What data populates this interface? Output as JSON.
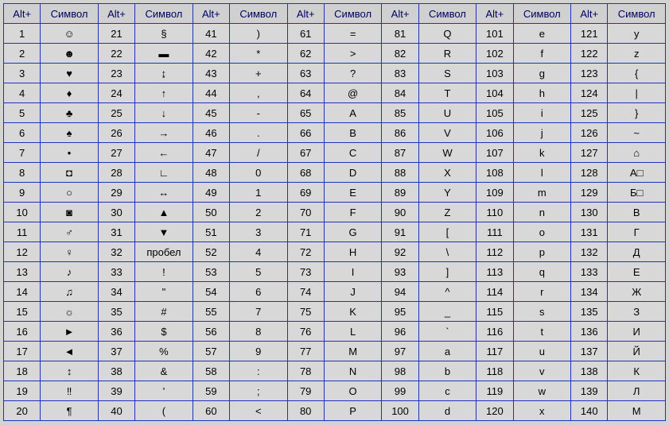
{
  "headers": {
    "alt": "Alt+",
    "symbol": "Символ"
  },
  "columns": [
    [
      {
        "alt": "1",
        "sym": "☺"
      },
      {
        "alt": "2",
        "sym": "☻"
      },
      {
        "alt": "3",
        "sym": "♥"
      },
      {
        "alt": "4",
        "sym": "♦"
      },
      {
        "alt": "5",
        "sym": "♣"
      },
      {
        "alt": "6",
        "sym": "♠"
      },
      {
        "alt": "7",
        "sym": "•"
      },
      {
        "alt": "8",
        "sym": "◘"
      },
      {
        "alt": "9",
        "sym": "○"
      },
      {
        "alt": "10",
        "sym": "◙"
      },
      {
        "alt": "11",
        "sym": "♂"
      },
      {
        "alt": "12",
        "sym": "♀"
      },
      {
        "alt": "13",
        "sym": "♪"
      },
      {
        "alt": "14",
        "sym": "♫"
      },
      {
        "alt": "15",
        "sym": "☼"
      },
      {
        "alt": "16",
        "sym": "►"
      },
      {
        "alt": "17",
        "sym": "◄"
      },
      {
        "alt": "18",
        "sym": "↕"
      },
      {
        "alt": "19",
        "sym": "‼"
      },
      {
        "alt": "20",
        "sym": "¶"
      }
    ],
    [
      {
        "alt": "21",
        "sym": "§"
      },
      {
        "alt": "22",
        "sym": "▬"
      },
      {
        "alt": "23",
        "sym": "↨"
      },
      {
        "alt": "24",
        "sym": "↑"
      },
      {
        "alt": "25",
        "sym": "↓"
      },
      {
        "alt": "26",
        "sym": "→"
      },
      {
        "alt": "27",
        "sym": "←"
      },
      {
        "alt": "28",
        "sym": "∟"
      },
      {
        "alt": "29",
        "sym": "↔"
      },
      {
        "alt": "30",
        "sym": "▲"
      },
      {
        "alt": "31",
        "sym": "▼"
      },
      {
        "alt": "32",
        "sym": "пробел"
      },
      {
        "alt": "33",
        "sym": "!"
      },
      {
        "alt": "34",
        "sym": "\""
      },
      {
        "alt": "35",
        "sym": "#"
      },
      {
        "alt": "36",
        "sym": "$"
      },
      {
        "alt": "37",
        "sym": "%"
      },
      {
        "alt": "38",
        "sym": "&"
      },
      {
        "alt": "39",
        "sym": "'"
      },
      {
        "alt": "40",
        "sym": "("
      }
    ],
    [
      {
        "alt": "41",
        "sym": ")"
      },
      {
        "alt": "42",
        "sym": "*"
      },
      {
        "alt": "43",
        "sym": "+"
      },
      {
        "alt": "44",
        "sym": ","
      },
      {
        "alt": "45",
        "sym": "-"
      },
      {
        "alt": "46",
        "sym": "."
      },
      {
        "alt": "47",
        "sym": "/"
      },
      {
        "alt": "48",
        "sym": "0"
      },
      {
        "alt": "49",
        "sym": "1"
      },
      {
        "alt": "50",
        "sym": "2"
      },
      {
        "alt": "51",
        "sym": "3"
      },
      {
        "alt": "52",
        "sym": "4"
      },
      {
        "alt": "53",
        "sym": "5"
      },
      {
        "alt": "54",
        "sym": "6"
      },
      {
        "alt": "55",
        "sym": "7"
      },
      {
        "alt": "56",
        "sym": "8"
      },
      {
        "alt": "57",
        "sym": "9"
      },
      {
        "alt": "58",
        "sym": ":"
      },
      {
        "alt": "59",
        "sym": ";"
      },
      {
        "alt": "60",
        "sym": "<"
      }
    ],
    [
      {
        "alt": "61",
        "sym": "="
      },
      {
        "alt": "62",
        "sym": ">"
      },
      {
        "alt": "63",
        "sym": "?"
      },
      {
        "alt": "64",
        "sym": "@"
      },
      {
        "alt": "65",
        "sym": "A"
      },
      {
        "alt": "66",
        "sym": "B"
      },
      {
        "alt": "67",
        "sym": "C"
      },
      {
        "alt": "68",
        "sym": "D"
      },
      {
        "alt": "69",
        "sym": "E"
      },
      {
        "alt": "70",
        "sym": "F"
      },
      {
        "alt": "71",
        "sym": "G"
      },
      {
        "alt": "72",
        "sym": "H"
      },
      {
        "alt": "73",
        "sym": "I"
      },
      {
        "alt": "74",
        "sym": "J"
      },
      {
        "alt": "75",
        "sym": "K"
      },
      {
        "alt": "76",
        "sym": "L"
      },
      {
        "alt": "77",
        "sym": "M"
      },
      {
        "alt": "78",
        "sym": "N"
      },
      {
        "alt": "79",
        "sym": "O"
      },
      {
        "alt": "80",
        "sym": "P"
      }
    ],
    [
      {
        "alt": "81",
        "sym": "Q"
      },
      {
        "alt": "82",
        "sym": "R"
      },
      {
        "alt": "83",
        "sym": "S"
      },
      {
        "alt": "84",
        "sym": "T"
      },
      {
        "alt": "85",
        "sym": "U"
      },
      {
        "alt": "86",
        "sym": "V"
      },
      {
        "alt": "87",
        "sym": "W"
      },
      {
        "alt": "88",
        "sym": "X"
      },
      {
        "alt": "89",
        "sym": "Y"
      },
      {
        "alt": "90",
        "sym": "Z"
      },
      {
        "alt": "91",
        "sym": "["
      },
      {
        "alt": "92",
        "sym": "\\"
      },
      {
        "alt": "93",
        "sym": "]"
      },
      {
        "alt": "94",
        "sym": "^"
      },
      {
        "alt": "95",
        "sym": "_"
      },
      {
        "alt": "96",
        "sym": "`"
      },
      {
        "alt": "97",
        "sym": "a"
      },
      {
        "alt": "98",
        "sym": "b"
      },
      {
        "alt": "99",
        "sym": "c"
      },
      {
        "alt": "100",
        "sym": "d"
      }
    ],
    [
      {
        "alt": "101",
        "sym": "e"
      },
      {
        "alt": "102",
        "sym": "f"
      },
      {
        "alt": "103",
        "sym": "g"
      },
      {
        "alt": "104",
        "sym": "h"
      },
      {
        "alt": "105",
        "sym": "i"
      },
      {
        "alt": "106",
        "sym": "j"
      },
      {
        "alt": "107",
        "sym": "k"
      },
      {
        "alt": "108",
        "sym": "l"
      },
      {
        "alt": "109",
        "sym": "m"
      },
      {
        "alt": "110",
        "sym": "n"
      },
      {
        "alt": "111",
        "sym": "o"
      },
      {
        "alt": "112",
        "sym": "p"
      },
      {
        "alt": "113",
        "sym": "q"
      },
      {
        "alt": "114",
        "sym": "r"
      },
      {
        "alt": "115",
        "sym": "s"
      },
      {
        "alt": "116",
        "sym": "t"
      },
      {
        "alt": "117",
        "sym": "u"
      },
      {
        "alt": "118",
        "sym": "v"
      },
      {
        "alt": "119",
        "sym": "w"
      },
      {
        "alt": "120",
        "sym": "x"
      }
    ],
    [
      {
        "alt": "121",
        "sym": "y"
      },
      {
        "alt": "122",
        "sym": "z"
      },
      {
        "alt": "123",
        "sym": "{"
      },
      {
        "alt": "124",
        "sym": "|"
      },
      {
        "alt": "125",
        "sym": "}"
      },
      {
        "alt": "126",
        "sym": "~"
      },
      {
        "alt": "127",
        "sym": "⌂"
      },
      {
        "alt": "128",
        "sym": "А□"
      },
      {
        "alt": "129",
        "sym": "Б□"
      },
      {
        "alt": "130",
        "sym": "В"
      },
      {
        "alt": "131",
        "sym": "Г"
      },
      {
        "alt": "132",
        "sym": "Д"
      },
      {
        "alt": "133",
        "sym": "Е"
      },
      {
        "alt": "134",
        "sym": "Ж"
      },
      {
        "alt": "135",
        "sym": "З"
      },
      {
        "alt": "136",
        "sym": "И"
      },
      {
        "alt": "137",
        "sym": "Й"
      },
      {
        "alt": "138",
        "sym": "К"
      },
      {
        "alt": "139",
        "sym": "Л"
      },
      {
        "alt": "140",
        "sym": "М"
      }
    ]
  ]
}
